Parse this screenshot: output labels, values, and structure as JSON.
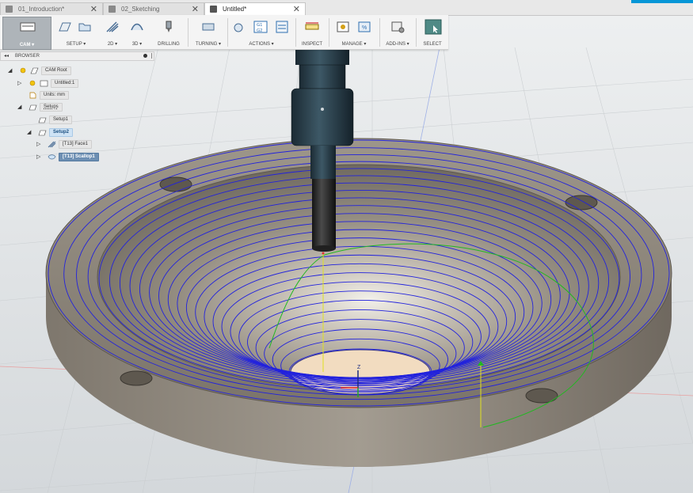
{
  "tabs": [
    {
      "label": "01_Introduction*",
      "active": false
    },
    {
      "label": "02_Sketching",
      "active": false
    },
    {
      "label": "Untitled*",
      "active": true
    }
  ],
  "toolbar": {
    "workspace": "CAM ▾",
    "groups": [
      {
        "id": "setup",
        "label": "SETUP ▾"
      },
      {
        "id": "2d",
        "label": "2D ▾"
      },
      {
        "id": "3d",
        "label": "3D ▾"
      },
      {
        "id": "drilling",
        "label": "DRILLING"
      },
      {
        "id": "turning",
        "label": "TURNING ▾"
      },
      {
        "id": "actions",
        "label": "ACTIONS ▾"
      },
      {
        "id": "inspect",
        "label": "INSPECT"
      },
      {
        "id": "manage",
        "label": "MANAGE ▾"
      },
      {
        "id": "addins",
        "label": "ADD-INS ▾"
      },
      {
        "id": "select",
        "label": "SELECT"
      }
    ],
    "actions_icon_text": "G1\nG2"
  },
  "browser": {
    "title": "BROWSER",
    "nodes": [
      {
        "label": "CAM Root"
      },
      {
        "label": "Untitled:1"
      },
      {
        "label": "Units: mm"
      },
      {
        "label": "Setups"
      },
      {
        "label": "Setup1"
      },
      {
        "label": "Setup2"
      },
      {
        "label": "[T13] Face1"
      },
      {
        "label": "[T13] Scallop1"
      }
    ]
  },
  "viewport": {
    "axis_label": "Z"
  },
  "colors": {
    "toolpath": "#2222dd",
    "linking": "#22b822",
    "plunge": "#e0e020",
    "part": "#8a8378",
    "background": "#dfe2e4",
    "selection": "#6d8fb3"
  }
}
